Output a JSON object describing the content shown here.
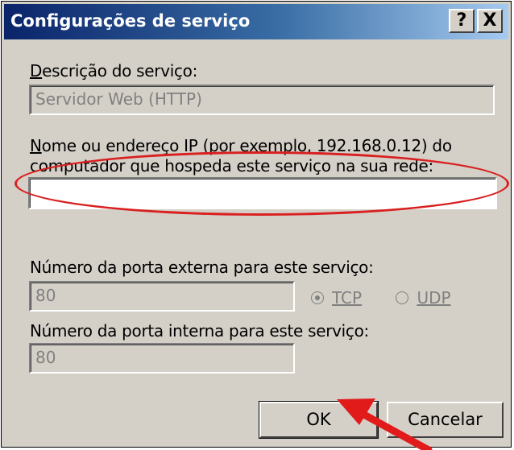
{
  "window": {
    "title": "Configurações de serviço",
    "help_button": "?",
    "close_button": "X"
  },
  "service_description": {
    "label": "Descrição do serviço:",
    "value": "Servidor Web (HTTP)"
  },
  "host": {
    "label_line1": "Nome ou endereço IP (por exemplo, 192.168.0.12) do",
    "label_line2": "computador que hospeda este serviço na sua rede:",
    "value": ""
  },
  "external_port": {
    "label": "Número da porta externa para este serviço:",
    "value": "80",
    "protocols": [
      "TCP",
      "UDP"
    ],
    "selected": "TCP"
  },
  "internal_port": {
    "label": "Número da porta interna para este serviço:",
    "value": "80"
  },
  "buttons": {
    "ok": "OK",
    "cancel": "Cancelar"
  },
  "annotation": {
    "ellipse_color": "#d91f1f",
    "arrow_color": "#e11a1a"
  }
}
